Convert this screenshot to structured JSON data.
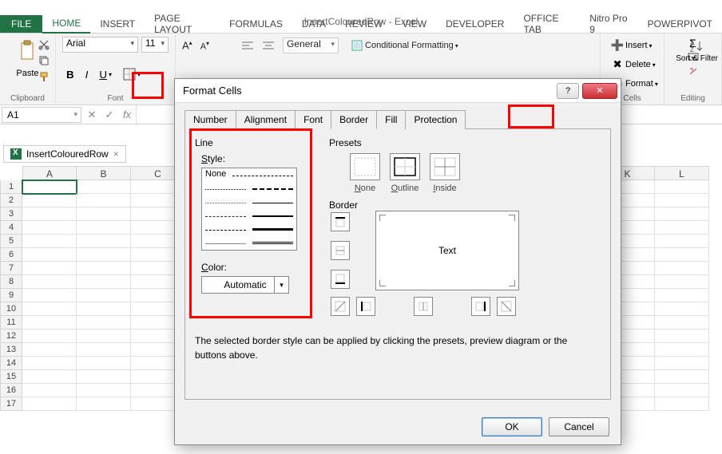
{
  "app": {
    "title": "InsertColouredRow - Excel"
  },
  "ribbon_tabs": {
    "file": "FILE",
    "home": "HOME",
    "insert": "INSERT",
    "page_layout": "PAGE LAYOUT",
    "formulas": "FORMULAS",
    "data": "DATA",
    "review": "REVIEW",
    "view": "VIEW",
    "developer": "DEVELOPER",
    "office_tab": "OFFICE TAB",
    "nitro": "Nitro Pro 9",
    "powerpivot": "POWERPIVOT"
  },
  "ribbon": {
    "clipboard": {
      "paste": "Paste",
      "label": "Clipboard"
    },
    "font": {
      "family": "Arial",
      "size": "11",
      "bold": "B",
      "italic": "I",
      "underline_label": "U",
      "label": "Font"
    },
    "number": {
      "format": "General"
    },
    "styles": {
      "cond": "Conditional Formatting"
    },
    "cells": {
      "insert": "Insert",
      "delete": "Delete",
      "format": "Format",
      "label": "Cells"
    },
    "editing": {
      "sort": "Sort & Filter",
      "label": "Editing"
    }
  },
  "formula_bar": {
    "namebox": "A1",
    "fx": "fx"
  },
  "workbook_tab": {
    "name": "InsertColouredRow",
    "close": "×"
  },
  "columns": [
    "A",
    "B",
    "C",
    "",
    "",
    "",
    "",
    "",
    "",
    "",
    "K",
    "L"
  ],
  "rows": [
    "1",
    "2",
    "3",
    "4",
    "5",
    "6",
    "7",
    "8",
    "9",
    "10",
    "11",
    "12",
    "13",
    "14",
    "15",
    "16",
    "17"
  ],
  "dialog": {
    "title": "Format Cells",
    "help": "?",
    "close": "✕",
    "tabs": {
      "number": "Number",
      "alignment": "Alignment",
      "font": "Font",
      "border": "Border",
      "fill": "Fill",
      "protection": "Protection"
    },
    "line_label": "Line",
    "style_label": "Style:",
    "style_none": "None",
    "color_label": "Color:",
    "color_value": "Automatic",
    "presets_label": "Presets",
    "preset_none": "None",
    "preset_outline": "Outline",
    "preset_inside": "Inside",
    "border_label": "Border",
    "preview_text": "Text",
    "hint": "The selected border style can be applied by clicking the presets, preview diagram or the buttons above.",
    "ok": "OK",
    "cancel": "Cancel"
  }
}
